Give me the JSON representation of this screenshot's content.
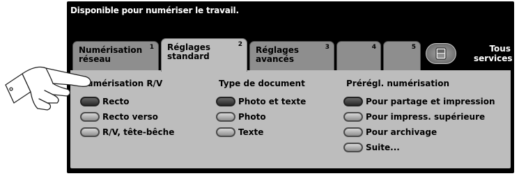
{
  "status_message": "Disponible pour numériser le travail.",
  "tabs": [
    {
      "line1": "Numérisation",
      "line2": "réseau",
      "num": "1"
    },
    {
      "line1": "Réglages",
      "line2": "standard",
      "num": "2"
    },
    {
      "line1": "Réglages",
      "line2": "avancés",
      "num": "3"
    },
    {
      "line1": "",
      "line2": "",
      "num": "4"
    },
    {
      "line1": "",
      "line2": "",
      "num": "5"
    }
  ],
  "all_services": {
    "line1": "Tous",
    "line2": "services",
    "icon": "copier-icon"
  },
  "columns": [
    {
      "heading": "Numérisation R/V",
      "options": [
        {
          "label": "Recto",
          "selected": true
        },
        {
          "label": "Recto verso",
          "selected": false
        },
        {
          "label": "R/V, tête-bêche",
          "selected": false
        }
      ]
    },
    {
      "heading": "Type de document",
      "options": [
        {
          "label": "Photo et texte",
          "selected": true
        },
        {
          "label": "Photo",
          "selected": false
        },
        {
          "label": "Texte",
          "selected": false
        }
      ]
    },
    {
      "heading": "Prérégl. numérisation",
      "options": [
        {
          "label": "Pour partage et impression",
          "selected": true
        },
        {
          "label": "Pour impress. supérieure",
          "selected": false
        },
        {
          "label": "Pour archivage",
          "selected": false
        },
        {
          "label": "Suite...",
          "selected": false
        }
      ]
    }
  ],
  "colors": {
    "screen": "#000000",
    "panel": "#bdbdbd",
    "tab": "#8e8e8e"
  },
  "pointer_icon": "pointing-hand-icon"
}
